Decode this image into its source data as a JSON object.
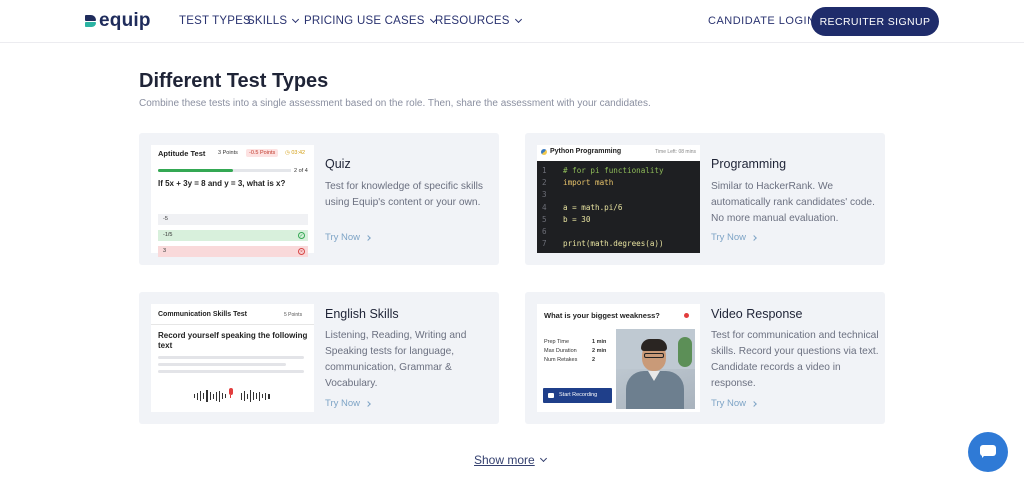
{
  "nav": {
    "brand": "equip",
    "items": [
      {
        "label": "TEST TYPES",
        "dropdown": false
      },
      {
        "label": "SKILLS",
        "dropdown": true
      },
      {
        "label": "PRICING",
        "dropdown": false
      },
      {
        "label": "USE CASES",
        "dropdown": true
      },
      {
        "label": "RESOURCES",
        "dropdown": true
      }
    ],
    "candidate_login": "CANDIDATE LOGIN",
    "recruiter_signup": "RECRUITER SIGNUP"
  },
  "section": {
    "title": "Different Test Types",
    "subtitle": "Combine these tests into a single assessment based on the role. Then, share the assessment with your candidates."
  },
  "cards": [
    {
      "title": "Quiz",
      "description": "Test for knowledge of specific skills using Equip's content or your own.",
      "cta": "Try Now"
    },
    {
      "title": "Programming",
      "description": "Similar to HackerRank. We automatically rank candidates' code. No more manual evaluation.",
      "cta": "Try Now"
    },
    {
      "title": "English Skills",
      "description": "Listening, Reading, Writing and Speaking tests for language, communication, Grammar & Vocabulary.",
      "cta": "Try Now"
    },
    {
      "title": "Video Response",
      "description": "Test for communication and technical skills. Record your questions via text. Candidate records a video in response.",
      "cta": "Try Now"
    }
  ],
  "quiz_shot": {
    "name": "Aptitude Test",
    "points": "3 Points",
    "negative": "-0.5 Points",
    "timer": "03:42",
    "progress_label": "2 of 4",
    "progress": 0.5,
    "question": "If 5x + 3y = 8 and y = 3, what is x?",
    "options": [
      {
        "text": "-5",
        "state": "neutral"
      },
      {
        "text": "-1/5",
        "state": "correct"
      },
      {
        "text": "3",
        "state": "wrong"
      }
    ]
  },
  "code_shot": {
    "name": "Python Programming",
    "time_left": "Time Left: 08 mins",
    "lines": [
      {
        "n": "1",
        "code": "# for pi functionality",
        "kind": "cm"
      },
      {
        "n": "2",
        "code": "import math",
        "kind": "kw"
      },
      {
        "n": "3",
        "code": "",
        "kind": ""
      },
      {
        "n": "4",
        "code": "a = math.pi/6",
        "kind": ""
      },
      {
        "n": "5",
        "code": "b = 30",
        "kind": ""
      },
      {
        "n": "6",
        "code": "",
        "kind": ""
      },
      {
        "n": "7",
        "code": "print(math.degrees(a))",
        "kind": ""
      }
    ]
  },
  "english_shot": {
    "name": "Communication Skills Test",
    "points": "5 Points",
    "prompt": "Record yourself speaking the following text"
  },
  "video_shot": {
    "question": "What is your biggest weakness?",
    "rows": [
      {
        "label": "Prep Time",
        "value": "1 min"
      },
      {
        "label": "Max Duration",
        "value": "2 min"
      },
      {
        "label": "Num Retakes",
        "value": "2"
      }
    ],
    "button": "Start Recording"
  },
  "show_more": "Show more",
  "colors": {
    "brand_navy": "#1f2c6b",
    "card_bg": "#f1f3f7",
    "link": "#7ea4c6",
    "chat": "#2f7ad6"
  }
}
